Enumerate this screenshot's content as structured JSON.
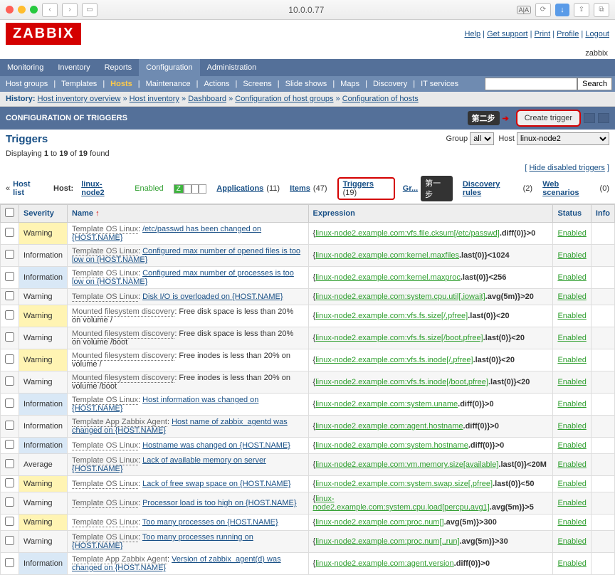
{
  "browser": {
    "url": "10.0.0.77"
  },
  "top_links": [
    "Help",
    "Get support",
    "Print",
    "Profile",
    "Logout"
  ],
  "user": "zabbix",
  "logo": "ZABBIX",
  "mainnav": [
    "Monitoring",
    "Inventory",
    "Reports",
    "Configuration",
    "Administration"
  ],
  "mainnav_active": 3,
  "subnav": [
    "Host groups",
    "Templates",
    "Hosts",
    "Maintenance",
    "Actions",
    "Screens",
    "Slide shows",
    "Maps",
    "Discovery",
    "IT services"
  ],
  "subnav_hl": 2,
  "search_btn": "Search",
  "history": {
    "label": "History:",
    "items": [
      "Host inventory overview",
      "Host inventory",
      "Dashboard",
      "Configuration of host groups",
      "Configuration of hosts"
    ]
  },
  "section_title": "CONFIGURATION OF TRIGGERS",
  "ann_step2": "第二步",
  "ann_step1": "第一步",
  "create_btn": "Create trigger",
  "page_title": "Triggers",
  "group_label": "Group",
  "group_value": "all",
  "host_label": "Host",
  "host_value": "linux-node2",
  "count_line": "Displaying 1 to 19 of 19 found",
  "hide_link": "Hide disabled triggers",
  "filter": {
    "hostlist": "Host list",
    "host_label": "Host:",
    "hostname": "linux-node2",
    "enabled": "Enabled",
    "z": "Z",
    "apps": "Applications",
    "apps_n": "(11)",
    "items": "Items",
    "items_n": "(47)",
    "trig": "Triggers",
    "trig_n": "(19)",
    "gr": "Gr...",
    "disc": "Discovery rules",
    "disc_n": "(2)",
    "web": "Web scenarios",
    "web_n": "(0)"
  },
  "col": {
    "sev": "Severity",
    "name": "Name",
    "expr": "Expression",
    "status": "Status",
    "info": "Info"
  },
  "status_txt": "Enabled",
  "rows": [
    {
      "sev": "Warning",
      "tpl": "Template OS Linux",
      "name": "/etc/passwd has been changed on {HOST.NAME}",
      "el": "linux-node2.example.com:vfs.file.cksum[/etc/passwd]",
      "tail": ".diff(0)}>0"
    },
    {
      "sev": "Information",
      "tpl": "Template OS Linux",
      "name": "Configured max number of opened files is too low on {HOST.NAME}",
      "el": "linux-node2.example.com:kernel.maxfiles",
      "tail": ".last(0)}<1024"
    },
    {
      "sev": "Information",
      "tpl": "Template OS Linux",
      "name": "Configured max number of processes is too low on {HOST.NAME}",
      "el": "linux-node2.example.com:kernel.maxproc",
      "tail": ".last(0)}<256"
    },
    {
      "sev": "Warning",
      "tpl": "Template OS Linux",
      "name": "Disk I/O is overloaded on {HOST.NAME}",
      "el": "linux-node2.example.com:system.cpu.util[,iowait]",
      "tail": ".avg(5m)}>20"
    },
    {
      "sev": "Warning",
      "tpl": "Mounted filesystem discovery",
      "name2": ": Free disk space is less than 20% on volume /",
      "el": "linux-node2.example.com:vfs.fs.size[/,pfree]",
      "tail": ".last(0)}<20"
    },
    {
      "sev": "Warning",
      "tpl": "Mounted filesystem discovery",
      "name2": ": Free disk space is less than 20% on volume /boot",
      "el": "linux-node2.example.com:vfs.fs.size[/boot,pfree]",
      "tail": ".last(0)}<20"
    },
    {
      "sev": "Warning",
      "tpl": "Mounted filesystem discovery",
      "name2": ": Free inodes is less than 20% on volume /",
      "el": "linux-node2.example.com:vfs.fs.inode[/,pfree]",
      "tail": ".last(0)}<20"
    },
    {
      "sev": "Warning",
      "tpl": "Mounted filesystem discovery",
      "name2": ": Free inodes is less than 20% on volume /boot",
      "el": "linux-node2.example.com:vfs.fs.inode[/boot,pfree]",
      "tail": ".last(0)}<20"
    },
    {
      "sev": "Information",
      "tpl": "Template OS Linux",
      "name": "Host information was changed on {HOST.NAME}",
      "el": "linux-node2.example.com:system.uname",
      "tail": ".diff(0)}>0"
    },
    {
      "sev": "Information",
      "tpl": "Template App Zabbix Agent",
      "name": "Host name of zabbix_agentd was changed on {HOST.NAME}",
      "el": "linux-node2.example.com:agent.hostname",
      "tail": ".diff(0)}>0"
    },
    {
      "sev": "Information",
      "tpl": "Template OS Linux",
      "name": "Hostname was changed on {HOST.NAME}",
      "el": "linux-node2.example.com:system.hostname",
      "tail": ".diff(0)}>0"
    },
    {
      "sev": "Average",
      "tpl": "Template OS Linux",
      "name": "Lack of available memory on server {HOST.NAME}",
      "el": "linux-node2.example.com:vm.memory.size[available]",
      "tail": ".last(0)}<20M"
    },
    {
      "sev": "Warning",
      "tpl": "Template OS Linux",
      "name": "Lack of free swap space on {HOST.NAME}",
      "el": "linux-node2.example.com:system.swap.size[,pfree]",
      "tail": ".last(0)}<50"
    },
    {
      "sev": "Warning",
      "tpl": "Template OS Linux",
      "name": "Processor load is too high on {HOST.NAME}",
      "el": "linux-node2.example.com:system.cpu.load[percpu,avg1]",
      "tail": ".avg(5m)}>5"
    },
    {
      "sev": "Warning",
      "tpl": "Template OS Linux",
      "name": "Too many processes on {HOST.NAME}",
      "el": "linux-node2.example.com:proc.num[]",
      "tail": ".avg(5m)}>300"
    },
    {
      "sev": "Warning",
      "tpl": "Template OS Linux",
      "name": "Too many processes running on {HOST.NAME}",
      "el": "linux-node2.example.com:proc.num[,,run]",
      "tail": ".avg(5m)}>30"
    },
    {
      "sev": "Information",
      "tpl": "Template App Zabbix Agent",
      "name": "Version of zabbix_agent(d) was changed on {HOST.NAME}",
      "el": "linux-node2.example.com:agent.version",
      "tail": ".diff(0)}>0"
    }
  ]
}
